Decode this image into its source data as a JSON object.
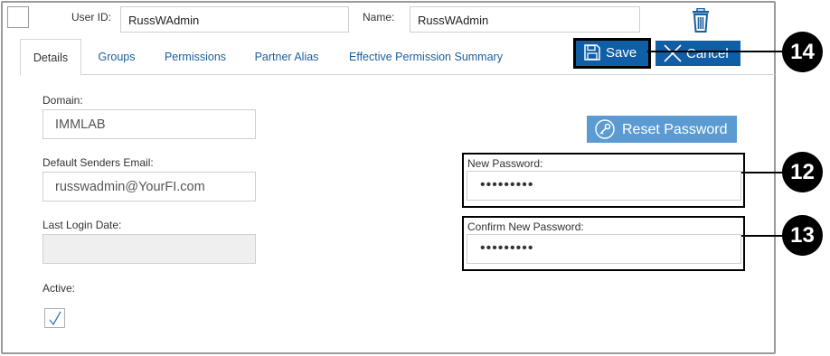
{
  "header": {
    "user_id_label": "User ID:",
    "user_id_value": "RussWAdmin",
    "name_label": "Name:",
    "name_value": "RussWAdmin"
  },
  "tabs": [
    {
      "label": "Details",
      "active": true
    },
    {
      "label": "Groups"
    },
    {
      "label": "Permissions"
    },
    {
      "label": "Partner Alias"
    },
    {
      "label": "Effective Permission Summary"
    }
  ],
  "toolbar": {
    "save_label": "Save",
    "cancel_label": "Cancel"
  },
  "form": {
    "domain_label": "Domain:",
    "domain_value": "IMMLAB",
    "email_label": "Default Senders Email:",
    "email_value": "russwadmin@YourFI.com",
    "last_login_label": "Last Login Date:",
    "last_login_value": "",
    "active_label": "Active:",
    "active_checked": true
  },
  "password": {
    "reset_label": "Reset Password",
    "new_label": "New Password:",
    "new_value": "•••••••••",
    "confirm_label": "Confirm New Password:",
    "confirm_value": "•••••••••"
  },
  "callouts": [
    "14",
    "12",
    "13"
  ],
  "colors": {
    "primary_button": "#0f5ea6",
    "reset_button": "#5b9bd1",
    "tab_link": "#1a5f9e",
    "readonly_bg": "#efefef"
  },
  "icons": [
    "trash-icon",
    "save-icon",
    "close-icon",
    "key-icon",
    "checkmark-icon"
  ]
}
